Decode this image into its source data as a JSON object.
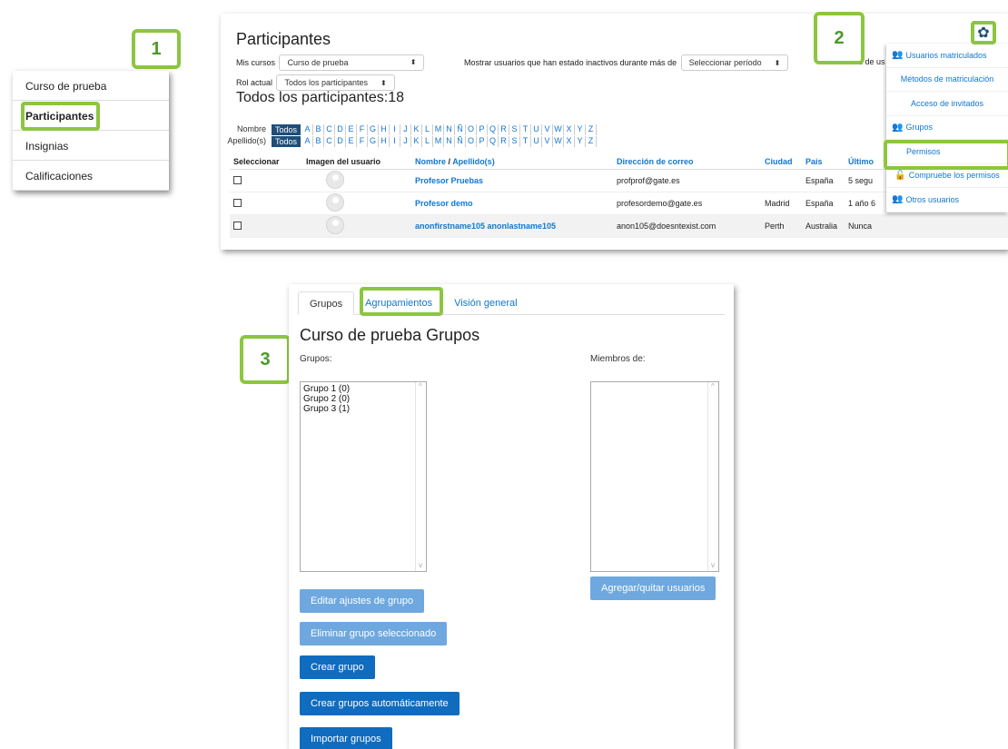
{
  "callouts": {
    "one": "1",
    "two": "2",
    "three": "3"
  },
  "panel1": {
    "items": [
      "Curso de prueba",
      "Participantes",
      "Insignias",
      "Calificaciones"
    ]
  },
  "panel2": {
    "title": "Participantes",
    "mis_cursos_label": "Mis cursos",
    "mis_cursos_value": "Curso de prueba",
    "inactive_label": "Mostrar usuarios que han estado inactivos durante más de",
    "inactive_value": "Seleccionar período",
    "truncated_right": "Más de us",
    "rol_label": "Rol actual",
    "rol_value": "Todos los participantes",
    "count_text": "Todos los participantes:18",
    "nombre_label": "Nombre",
    "apellido_label": "Apellido(s)",
    "todos_label": "Todos",
    "letters": [
      "A",
      "B",
      "C",
      "D",
      "E",
      "F",
      "G",
      "H",
      "I",
      "J",
      "K",
      "L",
      "M",
      "N",
      "Ñ",
      "O",
      "P",
      "Q",
      "R",
      "S",
      "T",
      "U",
      "V",
      "W",
      "X",
      "Y",
      "Z"
    ],
    "columns": {
      "seleccionar": "Seleccionar",
      "imagen": "Imagen del usuario",
      "nombre": "Nombre",
      "sep": " / ",
      "apellido": "Apellido(s)",
      "correo": "Dirección de correo",
      "ciudad": "Ciudad",
      "pais": "País",
      "ultimo": "Último"
    },
    "rows": [
      {
        "name": "Profesor Pruebas",
        "email": "profprof@gate.es",
        "city": "",
        "country": "España",
        "last": "5 segu"
      },
      {
        "name": "Profesor demo",
        "email": "profesordemo@gate.es",
        "city": "Madrid",
        "country": "España",
        "last": "1 año 6"
      },
      {
        "name": "anonfirstname105 anonlastname105",
        "email": "anon105@doesntexist.com",
        "city": "Perth",
        "country": "Australia",
        "last": "Nunca"
      }
    ],
    "gear_icon": "gear-icon",
    "dropdown": [
      "Usuarios matriculados",
      "Métodos de matriculación",
      "Acceso de invitados",
      "Grupos",
      "Permisos",
      "Compruebe los permisos",
      "Otros usuarios"
    ]
  },
  "panel3": {
    "tabs": [
      "Grupos",
      "Agrupamientos",
      "Visión general"
    ],
    "heading": "Curso de prueba Grupos",
    "grupos_label": "Grupos:",
    "miembros_label": "Miembros de:",
    "groups": [
      "Grupo 1 (0)",
      "Grupo 2 (0)",
      "Grupo 3 (1)"
    ],
    "buttons": {
      "editar": "Editar ajustes de grupo",
      "eliminar": "Eliminar grupo seleccionado",
      "crear": "Crear grupo",
      "auto": "Crear grupos automáticamente",
      "importar": "Importar grupos",
      "agregar": "Agregar/quitar usuarios"
    }
  },
  "colors": {
    "accent_green": "#8cc63f",
    "link_blue": "#1177d1",
    "button_dark": "#0f6cbf",
    "button_light": "#6ea8df"
  }
}
